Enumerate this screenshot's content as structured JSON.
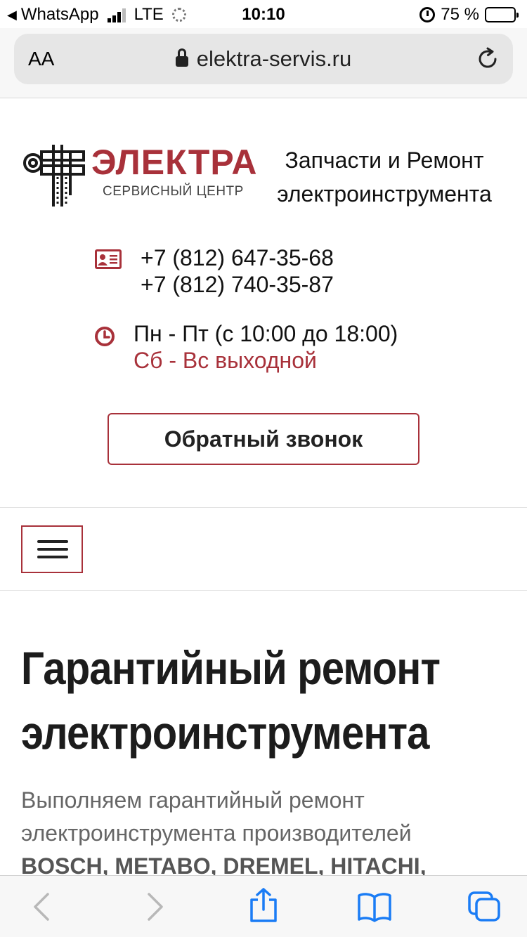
{
  "status_bar": {
    "back_app": "WhatsApp",
    "network": "LTE",
    "time": "10:10",
    "battery": "75 %",
    "battery_level": 0.75
  },
  "address_bar": {
    "text_size_label": "AA",
    "url": "elektra-servis.ru"
  },
  "header": {
    "logo_word": "ЭЛЕКТРА",
    "logo_subtitle": "СЕРВИСНЫЙ ЦЕНТР",
    "tagline_line1": "Запчасти и Ремонт",
    "tagline_line2": "электроинструмента"
  },
  "contacts": {
    "phones": [
      "+7 (812) 647-35-68",
      "+7 (812) 740-35-87"
    ],
    "hours_weekdays": "Пн - Пт (с 10:00 до 18:00)",
    "hours_weekend": "Сб - Вс выходной"
  },
  "callback_label": "Обратный звонок",
  "content": {
    "title_line1": "Гарантийный ремонт",
    "title_line2": "электроинструмента",
    "intro_line1": "Выполняем гарантийный ремонт",
    "intro_line2": "электроинструмента производителей",
    "intro_brands": "BOSCH, METABO, DREMEL, HITACHI,"
  },
  "colors": {
    "accent": "#a8313a",
    "safari_blue": "#1a7cf5",
    "disabled": "#b8b8b8"
  }
}
